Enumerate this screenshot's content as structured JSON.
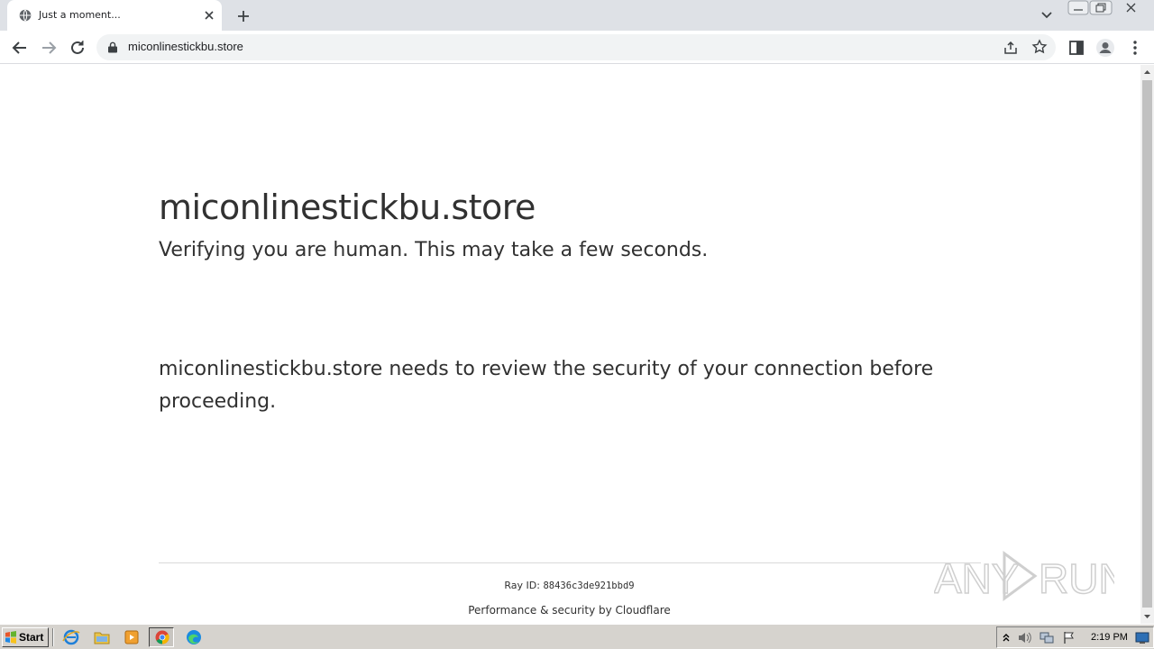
{
  "browser": {
    "tab": {
      "title": "Just a moment...",
      "favicon": "globe-icon"
    },
    "address_bar": {
      "url": "miconlinestickbu.store"
    }
  },
  "page": {
    "heading": "miconlinestickbu.store",
    "subheading": "Verifying you are human. This may take a few seconds.",
    "message": "miconlinestickbu.store needs to review the security of your connection before proceeding.",
    "ray_id_label": "Ray ID:",
    "ray_id_value": "88436c3de921bbd9",
    "footer": "Performance & security by Cloudflare",
    "watermark": "ANY RUN"
  },
  "taskbar": {
    "start_label": "Start",
    "clock": "2:19 PM",
    "quick_launch": [
      "ie-icon",
      "folder-icon",
      "media-player-icon",
      "chrome-icon",
      "edge-icon"
    ]
  },
  "colors": {
    "tabstrip": "#dee1e6",
    "omnibox": "#f1f3f4",
    "text": "#313131",
    "taskbar": "#d6d3ce"
  }
}
